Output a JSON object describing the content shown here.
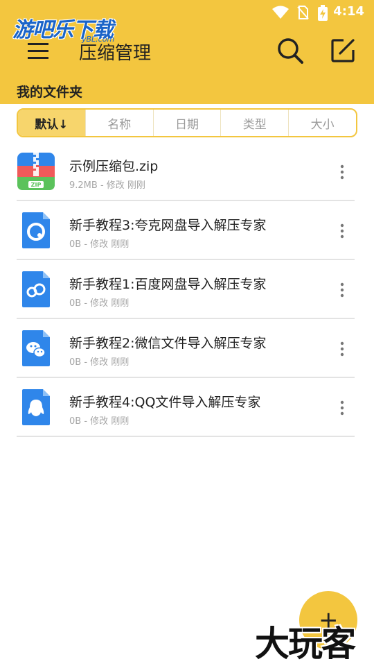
{
  "status_bar": {
    "time": "4:14"
  },
  "watermark": {
    "text": "游吧乐下载",
    "sub": "yBL.com"
  },
  "header": {
    "title": "压缩管理"
  },
  "section": {
    "label": "我的文件夹"
  },
  "sort_tabs": [
    {
      "label": "默认↓",
      "active": true
    },
    {
      "label": "名称",
      "active": false
    },
    {
      "label": "日期",
      "active": false
    },
    {
      "label": "类型",
      "active": false
    },
    {
      "label": "大小",
      "active": false
    }
  ],
  "files": [
    {
      "name": "示例压缩包.zip",
      "meta": "9.2MB - 修改 刚刚",
      "icon": "zip-archive-icon"
    },
    {
      "name": "新手教程3:夸克网盘导入解压专家",
      "meta": "0B - 修改 刚刚",
      "icon": "quark-file-icon"
    },
    {
      "name": "新手教程1:百度网盘导入解压专家",
      "meta": "0B - 修改 刚刚",
      "icon": "baidu-cloud-file-icon"
    },
    {
      "name": "新手教程2:微信文件导入解压专家",
      "meta": "0B - 修改 刚刚",
      "icon": "wechat-file-icon"
    },
    {
      "name": "新手教程4:QQ文件导入解压专家",
      "meta": "0B - 修改 刚刚",
      "icon": "qq-file-icon"
    }
  ],
  "fab": {
    "label": "+"
  },
  "brand_watermark": {
    "text": "大玩客"
  },
  "colors": {
    "accent": "#F3C63F",
    "accent_light": "#F7D56C",
    "file_icon_blue": "#2f86ea"
  }
}
